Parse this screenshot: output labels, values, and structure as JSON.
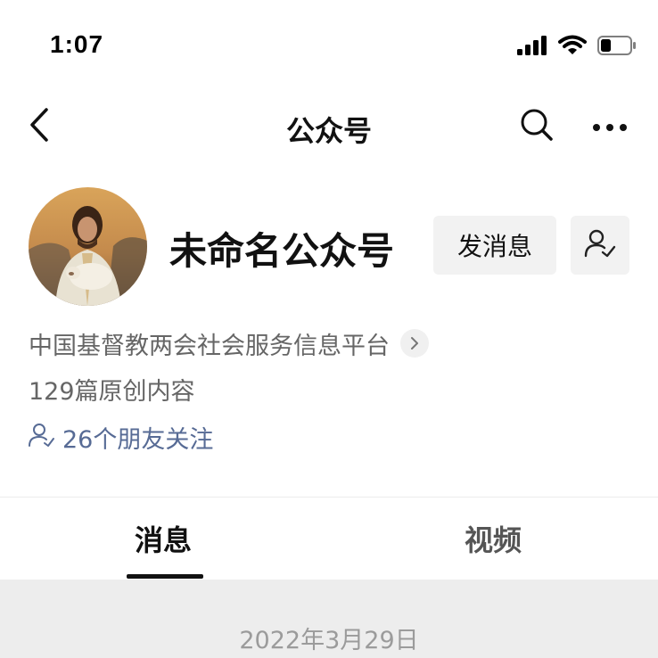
{
  "status_bar": {
    "time": "1:07",
    "icons": [
      "signal-icon",
      "wifi-icon",
      "battery-icon"
    ]
  },
  "nav": {
    "title": "公众号",
    "icons": [
      "back-icon",
      "search-icon",
      "more-icon"
    ]
  },
  "profile": {
    "name": "未命名公众号",
    "message_button_label": "发消息",
    "follow_icon": "user-check-icon",
    "subject": "中国基督教两会社会服务信息平台",
    "article_count": "129篇原创内容",
    "friends_following": "26个朋友关注"
  },
  "tabs": [
    {
      "label": "消息",
      "active": true
    },
    {
      "label": "视频",
      "active": false
    }
  ],
  "feed": {
    "date": "2022年3月29日"
  },
  "colors": {
    "link": "#576b95",
    "secondary_text": "#666666",
    "button_bg": "#f2f2f2",
    "feed_bg": "#ededed"
  }
}
